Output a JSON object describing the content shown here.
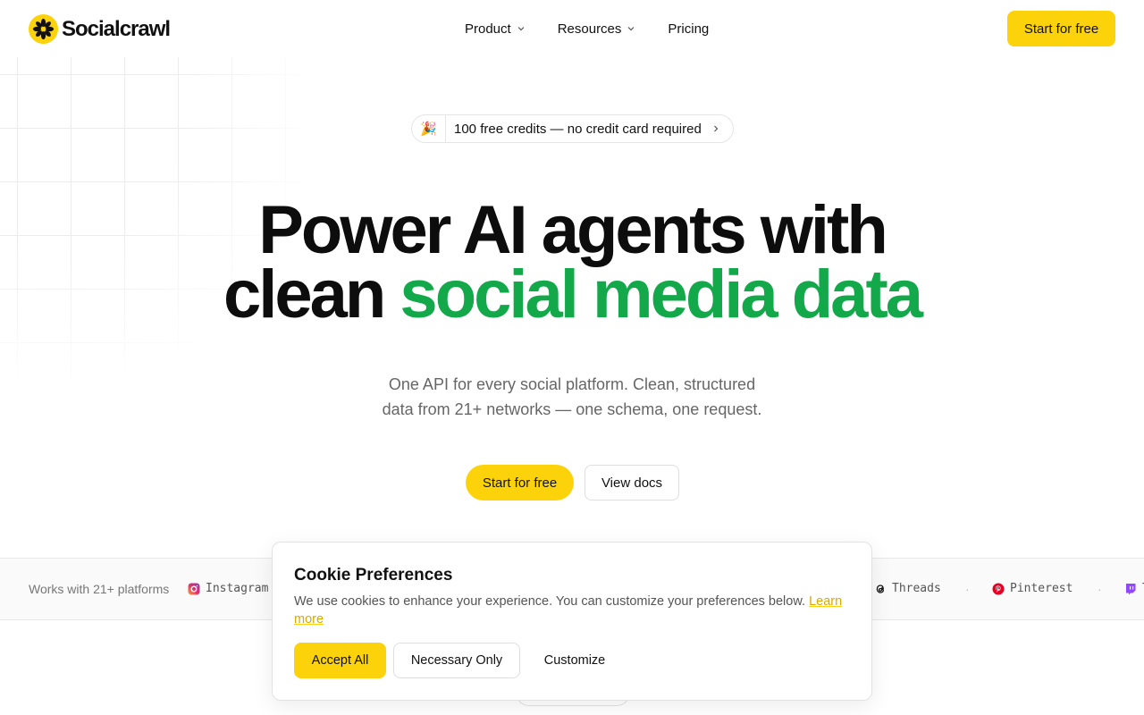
{
  "brand": {
    "name": "Socialcrawl",
    "logo_color": "#fcd20a"
  },
  "nav": {
    "items": [
      {
        "label": "Product",
        "has_dropdown": true
      },
      {
        "label": "Resources",
        "has_dropdown": true
      },
      {
        "label": "Pricing",
        "has_dropdown": false
      }
    ],
    "cta_label": "Start for free"
  },
  "hero": {
    "badge": {
      "emoji": "🎉",
      "text": "100 free credits — no credit card required"
    },
    "headline_line1": "Power AI agents with",
    "headline_line2_plain": "clean",
    "headline_line2_accent": "social media data",
    "subtitle_line1": "One API for every social platform. Clean, structured",
    "subtitle_line2": "data from 21+ networks — one schema, one request.",
    "primary_cta": "Start for free",
    "secondary_cta": "View docs"
  },
  "platforms": {
    "label": "Works with 21+ platforms",
    "items": [
      {
        "name": "Instagram",
        "icon": "instagram-icon"
      },
      {
        "name": "Threads",
        "icon": "threads-icon"
      },
      {
        "name": "Pinterest",
        "icon": "pinterest-icon"
      },
      {
        "name": "T",
        "icon": "twitch-icon"
      }
    ],
    "separator": "·"
  },
  "cookie": {
    "title": "Cookie Preferences",
    "text": "We use cookies to enhance your experience. You can customize your preferences below.",
    "link": "Learn more",
    "accept_label": "Accept All",
    "necessary_label": "Necessary Only",
    "customize_label": "Customize"
  },
  "colors": {
    "accent_yellow": "#fcd20a",
    "accent_green": "#13a84a"
  }
}
